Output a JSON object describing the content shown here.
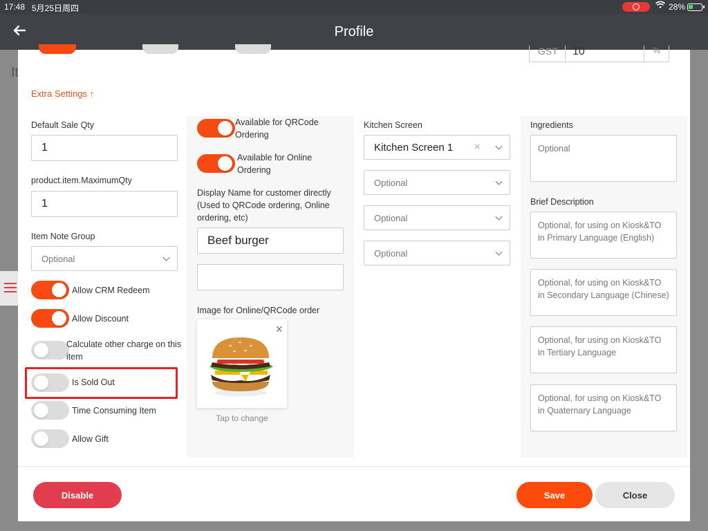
{
  "status_bar": {
    "time": "17:48",
    "date": "5月25日周四",
    "wifi": "wifi",
    "battery": "28%"
  },
  "header": {
    "title": "Profile"
  },
  "background": {
    "heading": "It"
  },
  "gst": {
    "label": "GST",
    "value": "10",
    "unit": "%"
  },
  "extra_settings": "Extra Settings ↑",
  "col1": {
    "default_sale_qty_label": "Default Sale Qty",
    "default_sale_qty_value": "1",
    "max_qty_label": "product.item.MaximumQty",
    "max_qty_value": "1",
    "note_group_label": "Item Note Group",
    "note_group_placeholder": "Optional",
    "toggles": [
      {
        "label": "Allow CRM Redeem",
        "on": true
      },
      {
        "label": "Allow Discount",
        "on": true
      },
      {
        "label": "Calculate other charge on this item",
        "on": false
      },
      {
        "label": "Is Sold Out",
        "on": false
      },
      {
        "label": "Time Consuming Item",
        "on": false
      },
      {
        "label": "Allow Gift",
        "on": false
      }
    ]
  },
  "col2": {
    "qrcode_toggle_label": "Available for QRCode Ordering",
    "online_toggle_label": "Available for Online Ordering",
    "display_name_label": "Display Name for customer directly (Used to QRCode ordering, Online ordering, etc)",
    "display_name_value": "Beef burger",
    "display_name_2_value": "",
    "image_label": "Image for Online/QRCode order",
    "remove_image": "×",
    "tap_to_change": "Tap to change"
  },
  "col3": {
    "kitchen_screen_label": "Kitchen Screen",
    "kitchen_screen_value": "Kitchen Screen 1",
    "optional_1": "Optional",
    "optional_2": "Optional",
    "optional_3": "Optional"
  },
  "col4": {
    "ingredients_label": "Ingredients",
    "ingredients_placeholder": "Optional",
    "brief_label": "Brief Description",
    "brief_primary": "Optional, for using on Kiosk&TO in Primary Language (English)",
    "brief_secondary": "Optional, for using on Kiosk&TO in Secondary Language (Chinese)",
    "brief_tertiary": "Optional, for using on Kiosk&TO in Tertiary Language",
    "brief_quaternary": "Optional, for using on Kiosk&TO in Quaternary Language"
  },
  "footer": {
    "disable": "Disable",
    "save": "Save",
    "close": "Close"
  },
  "colors": {
    "accent": "#f64a12",
    "danger": "#e23d4f",
    "header": "#3f4247"
  }
}
